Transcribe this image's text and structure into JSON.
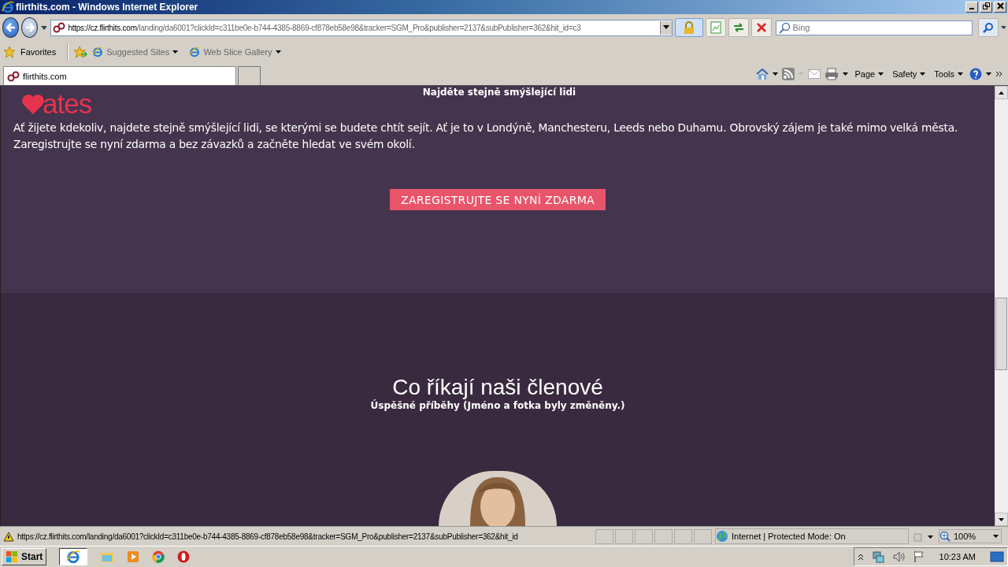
{
  "window": {
    "title": "flirthits.com - Windows Internet Explorer"
  },
  "address_bar": {
    "url_host": "https://cz.flirthits.com",
    "url_rest": "/landing/da6001?clickId=c311be0e-b744-4385-8869-cf878eb58e98&tracker=SGM_Pro&publisher=2137&subPublisher=362&hit_id=c3"
  },
  "search": {
    "placeholder": "Bing"
  },
  "favorites_bar": {
    "favorites": "Favorites",
    "items": [
      "Suggested Sites",
      "Web Slice Gallery"
    ]
  },
  "tabs": [
    {
      "label": "flirthits.com",
      "selected": true
    }
  ],
  "command_bar": [
    "Page",
    "Safety",
    "Tools"
  ],
  "page": {
    "logo": "ates",
    "tagline": "Najděte stejně smýšlející lidi",
    "intro": "Ať žijete kdekoliv, najdete stejně smýšlející lidi, se kterými se budete chtít sejít. Ať je to v Londýně, Manchesteru, Leeds nebo Duhamu. Obrovský zájem je také mimo velká města. Zaregistrujte se nyní zdarma a bez závazků a začněte hledat ve svém okolí.",
    "cta": "ZAREGISTRUJTE SE NYNÍ ZDARMA",
    "heading": "Co říkají naši členové",
    "subheading": "Úspěšné příběhy (Jméno a fotka byly změněny.)"
  },
  "status_bar": {
    "url": "https://cz.flirthits.com/landing/da6001?clickId=c311be0e-b744-4385-8869-cf878eb58e98&tracker=SGM_Pro&publisher=2137&subPublisher=362&hit_id",
    "zone": "Internet | Protected Mode: On",
    "zoom": "100%"
  },
  "taskbar": {
    "start": "Start",
    "clock": "10:23 AM"
  }
}
